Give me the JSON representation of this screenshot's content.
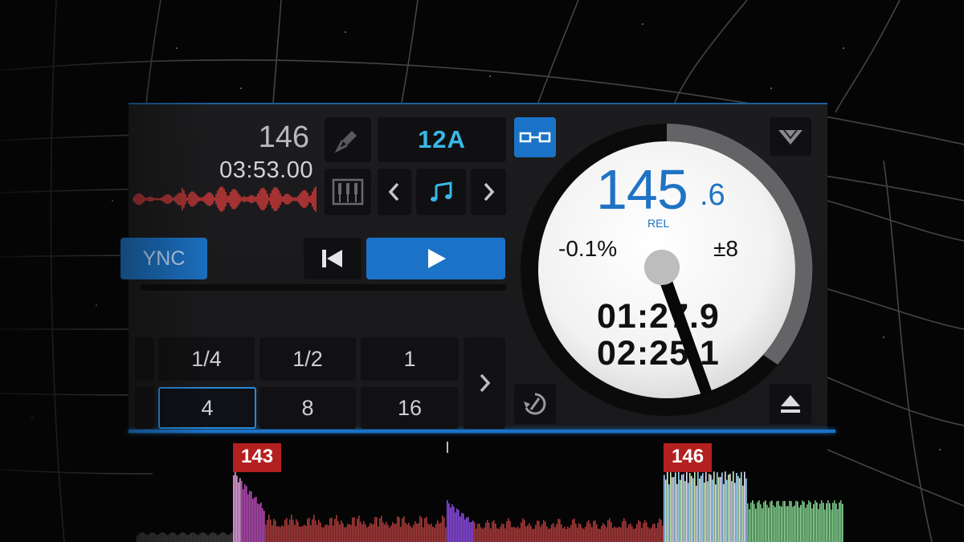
{
  "deck": {
    "track_bpm": "146",
    "track_length": "03:53.00",
    "sync_label": "YNC",
    "key": "12A"
  },
  "platter": {
    "bpm_integer": "145",
    "bpm_decimal": ".6",
    "mode_label": "REL",
    "pitch_percent": "-0.1%",
    "pitch_range": "±8",
    "time_elapsed": "01:27.9",
    "time_remaining": "02:25.1"
  },
  "loops": {
    "row1": [
      "1/4",
      "1/2",
      "1"
    ],
    "row2": [
      "4",
      "8",
      "16"
    ],
    "selected": "4"
  },
  "overview": {
    "cue_left_bpm": "143",
    "cue_right_bpm": "146"
  },
  "icons": {
    "mic": "microphone-icon",
    "sampler": "sampler-icon",
    "prev": "chevron-left-icon",
    "next": "chevron-right-icon",
    "music": "music-note-icon",
    "link": "link-icon",
    "logo": "logo-icon",
    "back": "skip-back-icon",
    "play": "play-icon",
    "loop_next": "chevron-right-icon",
    "spin": "slip-icon",
    "eject": "eject-icon"
  },
  "colors": {
    "accent": "#1b73c8",
    "key": "#39b8e6",
    "cue": "#b2201f"
  }
}
